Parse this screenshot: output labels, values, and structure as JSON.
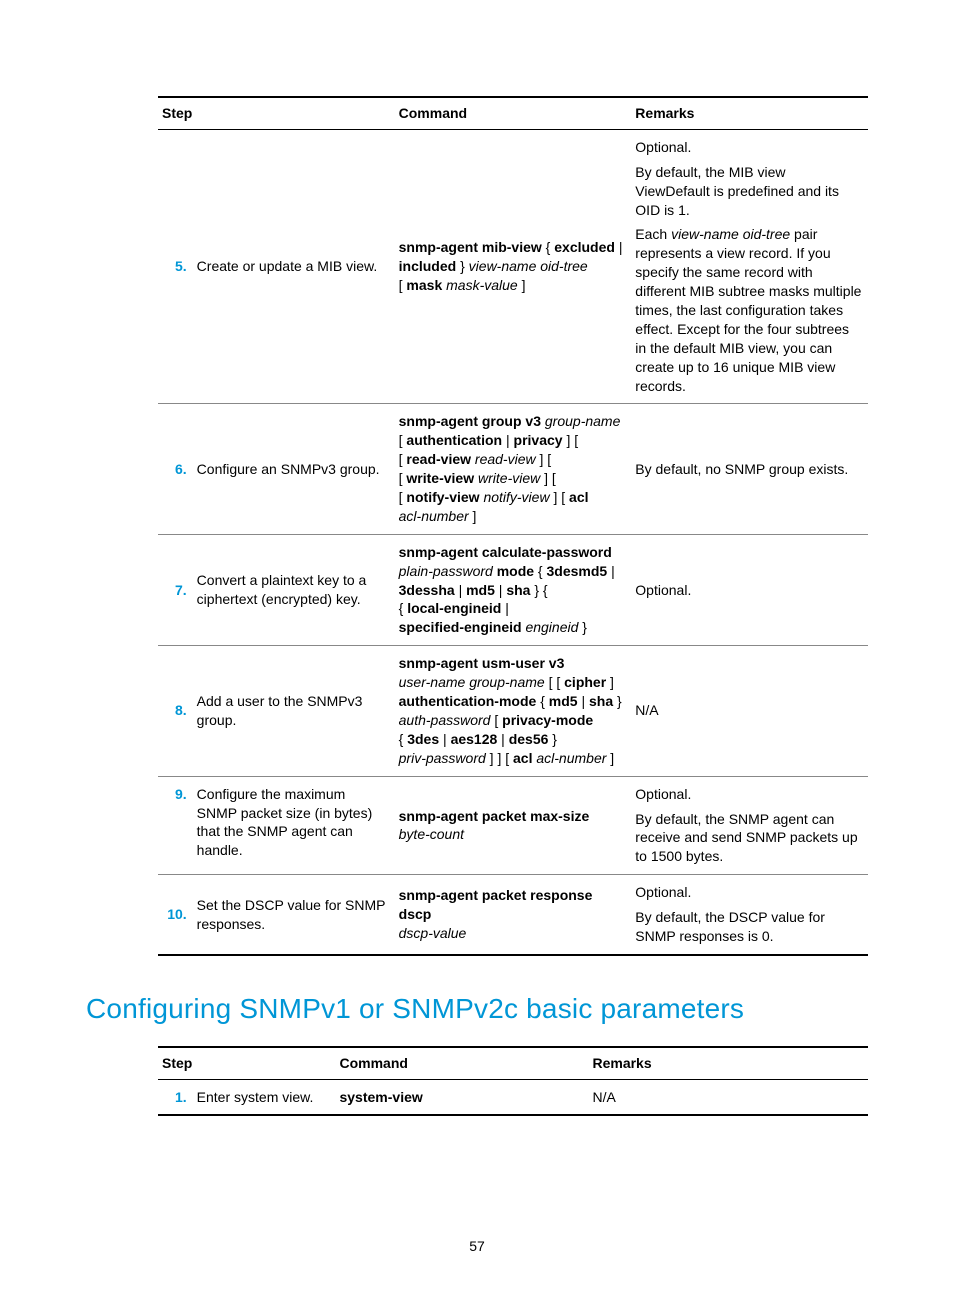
{
  "page_number": "57",
  "table1": {
    "headers": {
      "step": "Step",
      "command": "Command",
      "remarks": "Remarks"
    },
    "rows": {
      "r5": {
        "num": "5.",
        "step": "Create or update a MIB view.",
        "remarks_p1": "Optional.",
        "remarks_p2": "By default, the MIB view ViewDefault is predefined and its OID is 1.",
        "remarks_p3a": "Each ",
        "remarks_p3b": "view-name oid-tree",
        "remarks_p3c": " pair represents a view record. If you specify the same record with different MIB subtree masks multiple times, the last configuration takes effect. Except for the four subtrees in the default MIB view, you can create up to 16 unique MIB view records.",
        "cmd_a": "snmp-agent mib-view",
        "cmd_b": " { ",
        "cmd_c": "excluded",
        "cmd_d": " | ",
        "cmd_e": "included",
        "cmd_f": " } ",
        "cmd_g": "view-name oid-tree",
        "cmd_h": " [ ",
        "cmd_i": "mask",
        "cmd_j": " ",
        "cmd_k": "mask-value",
        "cmd_l": " ]"
      },
      "r6": {
        "num": "6.",
        "step": "Configure an SNMPv3 group.",
        "remarks": "By default, no SNMP group exists.",
        "c1": "snmp-agent group v3",
        "c2": " ",
        "c3": "group-name",
        "c4": " [ ",
        "c5": "authentication",
        "c6": " | ",
        "c7": "privacy",
        "c8": " ] [ ",
        "c9": "read-view",
        "c10": " ",
        "c11": "read-view",
        "c12": " ] [ ",
        "c13": "write-view",
        "c14": " ",
        "c15": "write-view",
        "c16": " ] [ ",
        "c17": "notify-view",
        "c18": " ",
        "c19": "notify-view",
        "c20": " ] [ ",
        "c21": "acl",
        "c22": " ",
        "c23": "acl-number",
        "c24": " ]"
      },
      "r7": {
        "num": "7.",
        "step": "Convert a plaintext key to a ciphertext (encrypted) key.",
        "remarks": "Optional.",
        "c1": "snmp-agent calculate-password",
        "c2": " ",
        "c3": "plain-password",
        "c4": " ",
        "c5": "mode",
        "c6": " { ",
        "c7": "3desmd5",
        "c8": " | ",
        "c9": "3dessha",
        "c10": " | ",
        "c11": "md5",
        "c12": " | ",
        "c13": "sha",
        "c14": " } { ",
        "c15": "local-engineid",
        "c16": " | ",
        "c17": "specified-engineid",
        "c18": " ",
        "c19": "engineid",
        "c20": " }"
      },
      "r8": {
        "num": "8.",
        "step": "Add a user to the SNMPv3 group.",
        "remarks": "N/A",
        "c1": "snmp-agent usm-user v3",
        "c2": " ",
        "c3": "user-name group-name",
        "c4": " [ [ ",
        "c5": "cipher",
        "c6": " ] ",
        "c7": "authentication-mode",
        "c8": " { ",
        "c9": "md5",
        "c10": " | ",
        "c11": "sha",
        "c12": " } ",
        "c13": "auth-password",
        "c14": " [ ",
        "c15": "privacy-mode",
        "c16": " { ",
        "c17": "3des",
        "c18": " | ",
        "c19": "aes128",
        "c20": " | ",
        "c21": "des56",
        "c22": " } ",
        "c23": "priv-password",
        "c24": " ] ] [ ",
        "c25": "acl",
        "c26": " ",
        "c27": "acl-number",
        "c28": " ]"
      },
      "r9": {
        "num": "9.",
        "step": "Configure the maximum SNMP packet size (in bytes) that the SNMP agent can handle.",
        "remarks_p1": "Optional.",
        "remarks_p2": "By default, the SNMP agent can receive and send SNMP packets up to 1500 bytes.",
        "c1": "snmp-agent packet max-size",
        "c2": " ",
        "c3": "byte-count"
      },
      "r10": {
        "num": "10.",
        "step": "Set the DSCP value for SNMP responses.",
        "remarks_p1": "Optional.",
        "remarks_p2": "By default, the DSCP value for SNMP responses is 0.",
        "c1": "snmp-agent packet response dscp",
        "c2": " ",
        "c3": "dscp-value"
      }
    }
  },
  "heading2": "Configuring SNMPv1 or SNMPv2c basic parameters",
  "table2": {
    "headers": {
      "step": "Step",
      "command": "Command",
      "remarks": "Remarks"
    },
    "rows": {
      "r1": {
        "num": "1.",
        "step": "Enter system view.",
        "cmd": "system-view",
        "remarks": "N/A"
      }
    }
  }
}
